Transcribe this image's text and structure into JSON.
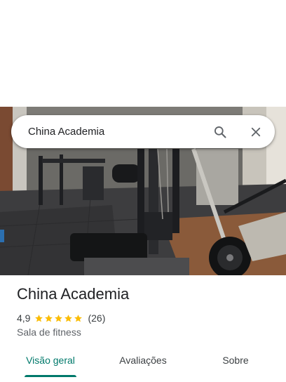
{
  "search": {
    "query": "China Academia"
  },
  "place": {
    "name": "China Academia",
    "rating": "4,9",
    "stars": 5,
    "review_count": "(26)",
    "category": "Sala de fitness"
  },
  "tabs": [
    {
      "label": "Visão geral",
      "active": true
    },
    {
      "label": "Avaliações",
      "active": false
    },
    {
      "label": "Sobre",
      "active": false
    }
  ],
  "icons": {
    "search": "search-icon",
    "close": "close-icon",
    "star": "star-icon"
  },
  "colors": {
    "accent": "#00796b",
    "star": "#fbbc04",
    "text_primary": "#202124",
    "text_secondary": "#5f6368"
  }
}
